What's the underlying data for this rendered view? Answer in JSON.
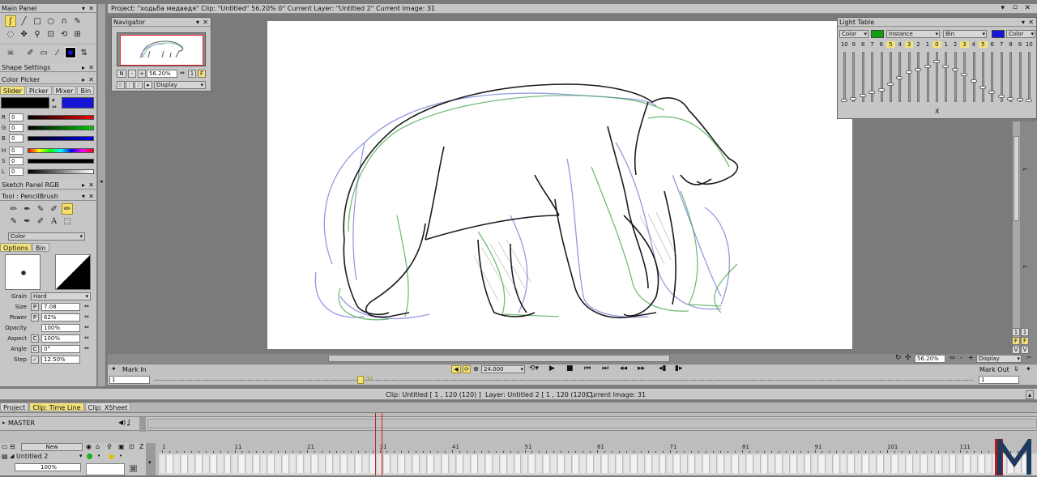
{
  "title_bar": {
    "project_info": "Project: \"ходьба медведя\"  Clip: \"Untitled\"  56.20%  0°  Current Layer: \"Untitled 2\"  Current Image: 31"
  },
  "main_panel": {
    "title": "Main Panel",
    "shape_settings": "Shape Settings",
    "color_picker": {
      "title": "Color Picker",
      "tabs": [
        "Slider",
        "Picker",
        "Mixer",
        "Bin"
      ],
      "channels": [
        {
          "label": "R",
          "value": "0"
        },
        {
          "label": "G",
          "value": "0"
        },
        {
          "label": "B",
          "value": "0"
        },
        {
          "label": "H",
          "value": "0"
        },
        {
          "label": "S",
          "value": "0"
        },
        {
          "label": "L",
          "value": "0"
        }
      ]
    },
    "sketch_panel": "Sketch Panel RGB",
    "tool_title": "Tool : PencilBrush",
    "color_mode": "Color",
    "option_tabs": [
      "Options",
      "Bin"
    ],
    "props": [
      {
        "label": "Grain",
        "value": "Hard",
        "flag": ""
      },
      {
        "label": "Size",
        "value": "7.08",
        "flag": "P"
      },
      {
        "label": "Power",
        "value": "62%",
        "flag": "P"
      },
      {
        "label": "Opacity",
        "value": "100%",
        "flag": ""
      },
      {
        "label": "Aspect",
        "value": "100%",
        "flag": "C"
      },
      {
        "label": "Angle",
        "value": "0°",
        "flag": "C"
      },
      {
        "label": "Step",
        "value": "12.50%",
        "flag": "✓"
      }
    ]
  },
  "navigator": {
    "title": "Navigator",
    "zoom": "56.20%",
    "btn_n": "N",
    "btn_minus": "-",
    "btn_plus": "+",
    "btn_one": "1",
    "btn_f": "F",
    "display": "Display"
  },
  "light_table": {
    "title": "Light Table",
    "color_left": "Color",
    "instance": "Instance",
    "bin": "Bin",
    "color_right": "Color",
    "numbers": [
      "10",
      "9",
      "8",
      "7",
      "6",
      "5",
      "4",
      "3",
      "2",
      "1",
      "0",
      "1",
      "2",
      "3",
      "4",
      "5",
      "6",
      "7",
      "8",
      "9",
      "10"
    ],
    "highlight": [
      "5",
      "3",
      "0",
      "3",
      "5"
    ],
    "x_label": "X"
  },
  "right_strip": {
    "one_a": "1",
    "one_b": "1",
    "f_a": "F",
    "f_b": "F",
    "v_a": "V",
    "v_b": "V"
  },
  "canvas_bar": {
    "zoom": "56.20%",
    "display": "Display"
  },
  "playback": {
    "mark_in": "Mark In",
    "mark_out": "Mark Out",
    "fps": "24.000",
    "start": "1",
    "end": "1",
    "current": "31"
  },
  "status_bar": {
    "clip": "Clip: Untitled [ 1 , 120  (120) ]",
    "layer": "Layer: Untitled 2 [ 1 , 120  (120) ]",
    "current": "Current Image: 31"
  },
  "bottom_tabs": [
    "Project",
    "Clip: Time Line",
    "Clip: XSheet"
  ],
  "timeline": {
    "master": "MASTER",
    "new_btn": "New",
    "layer_name": "Untitled 2",
    "opacity": "100%",
    "z_label": "Z",
    "ruler": [
      "1",
      "11",
      "21",
      "31",
      "41",
      "51",
      "61",
      "71",
      "81",
      "91",
      "101",
      "111"
    ]
  },
  "colors": {
    "primary": "#000000",
    "secondary": "#1515d6",
    "accent_green": "#0fa00f",
    "highlight": "#f3e27a"
  }
}
